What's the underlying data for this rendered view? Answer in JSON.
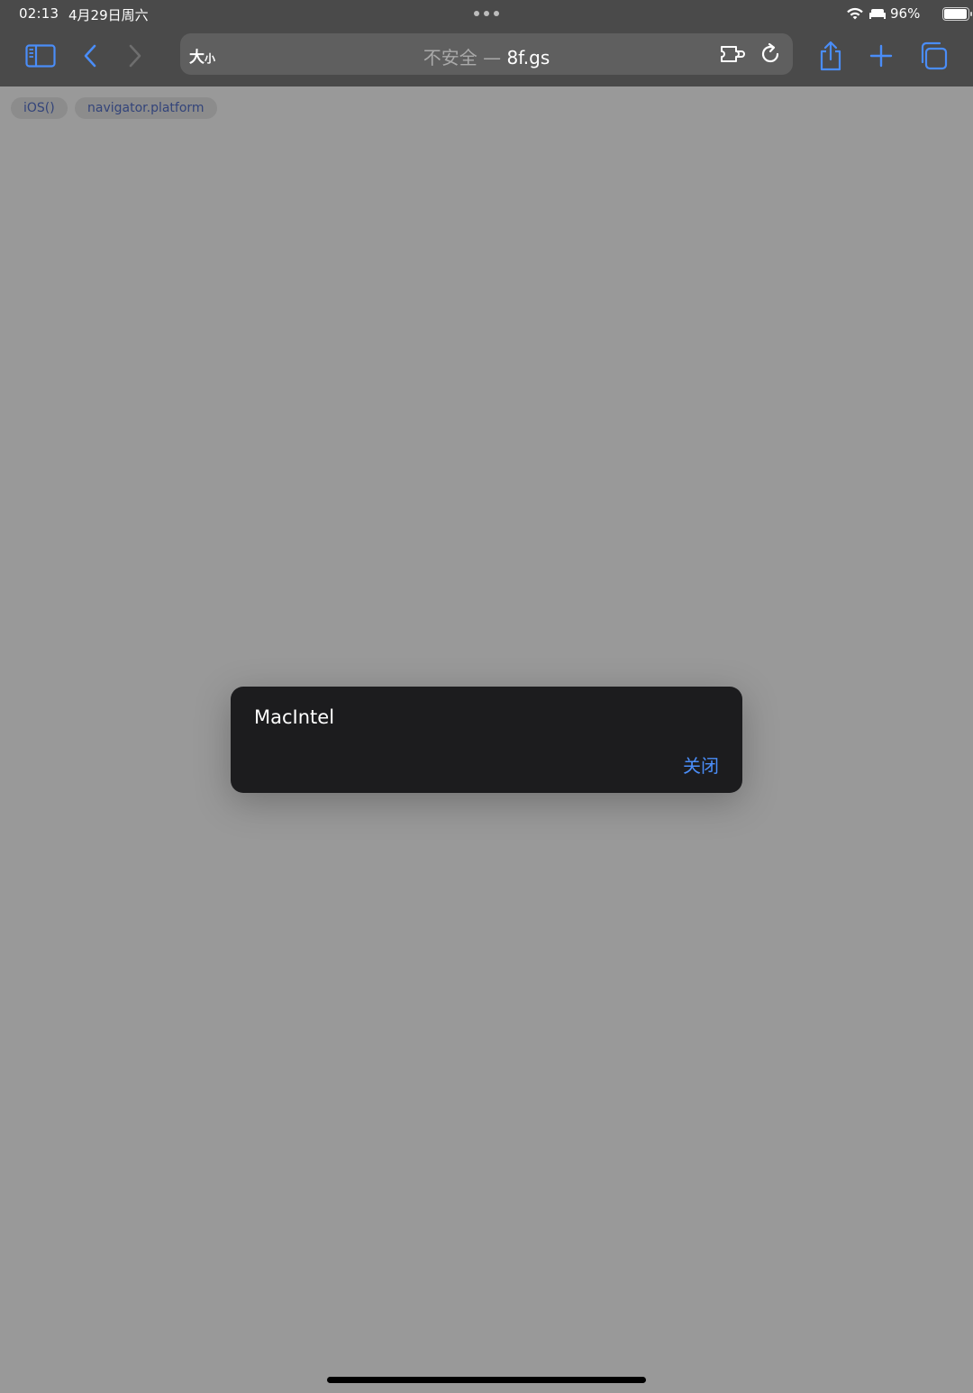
{
  "status_bar": {
    "time": "02:13",
    "date": "4月29日周六",
    "battery_percent": "96%",
    "battery_level": 0.96,
    "icons": [
      "wifi-icon",
      "bed-icon",
      "battery-icon"
    ]
  },
  "toolbar": {
    "icons": [
      "sidebar-icon",
      "back-icon",
      "forward-icon",
      "share-icon",
      "new-tab-icon",
      "tabs-icon"
    ],
    "url": {
      "size_label_big": "大",
      "size_label_small": "小",
      "insecure_label": "不安全 — ",
      "domain": "8f.gs",
      "icons": [
        "extension-icon",
        "reload-icon"
      ]
    }
  },
  "page": {
    "chips": [
      "iOS()",
      "navigator.platform"
    ]
  },
  "alert": {
    "message": "MacIntel",
    "close_label": "关闭"
  },
  "colors": {
    "accent": "#4a8df8",
    "toolbar_bg": "#4a4a4a",
    "page_bg": "#999999",
    "alert_bg": "#1c1c1e"
  }
}
